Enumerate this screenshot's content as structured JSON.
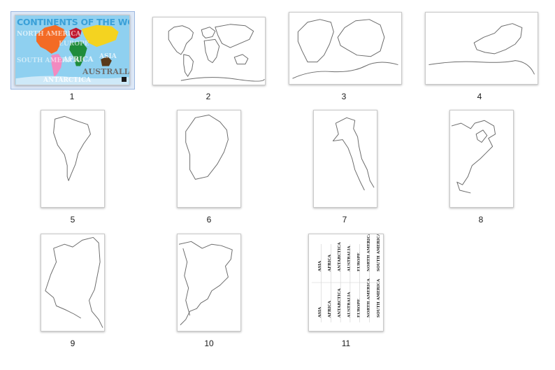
{
  "pages": [
    {
      "number": "1",
      "kind": "cover",
      "selected": true
    },
    {
      "number": "2",
      "kind": "world-outline-map"
    },
    {
      "number": "3",
      "kind": "outline-australia-africa"
    },
    {
      "number": "4",
      "kind": "outline-asia-strip"
    },
    {
      "number": "5",
      "kind": "outline-south-america"
    },
    {
      "number": "6",
      "kind": "outline-africa"
    },
    {
      "number": "7",
      "kind": "outline-north-america-top"
    },
    {
      "number": "8",
      "kind": "outline-north-america-bottom"
    },
    {
      "number": "9",
      "kind": "outline-europe"
    },
    {
      "number": "10",
      "kind": "outline-asia"
    },
    {
      "number": "11",
      "kind": "continent-name-labels"
    }
  ],
  "cover": {
    "title": "CONTINENTS OF THE WORLD",
    "words": [
      "NORTH AMERICA",
      "EUROPE",
      "ASIA",
      "AFRICA",
      "SOUTH AMERICA",
      "AUSTRALIA",
      "ANTARCTICA"
    ],
    "colors": {
      "background": "#8fd0f0",
      "north_america": "#f36b25",
      "south_america": "#f28ac0",
      "europe": "#c0182f",
      "africa": "#1f8c3b",
      "asia": "#f4d320",
      "australia": "#5a3a1a"
    }
  },
  "labels_page": {
    "names": [
      "ASIA",
      "AFRICA",
      "ANTARCTICA",
      "AUSTRALIA",
      "EUROPE",
      "NORTH AMERICA",
      "SOUTH AMERICA"
    ]
  }
}
